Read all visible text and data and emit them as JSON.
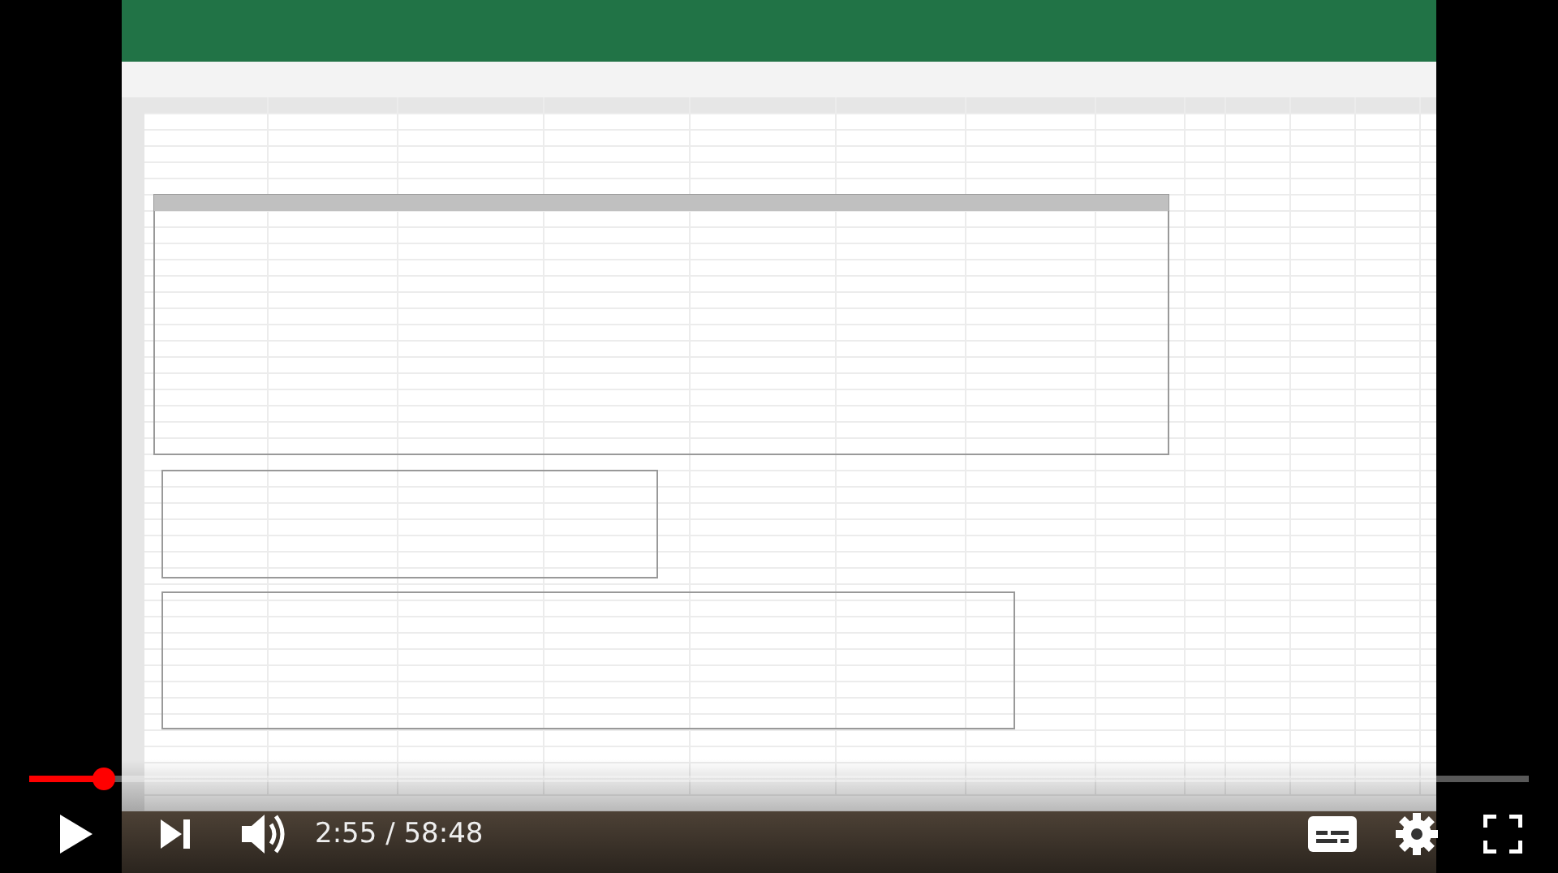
{
  "player": {
    "playing": false,
    "progress": {
      "level": 0.05
    },
    "time": "2:55 / 58:48"
  }
}
